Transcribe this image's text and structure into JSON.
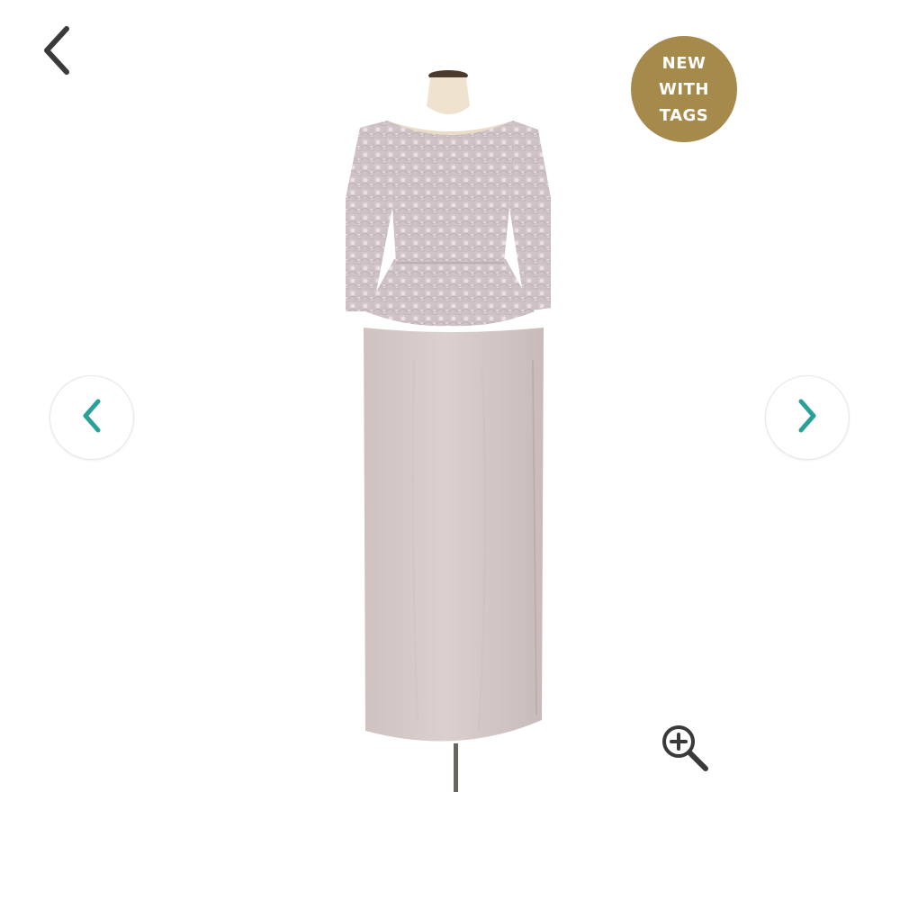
{
  "navigation": {
    "back_icon": "chevron-left-icon",
    "prev_icon": "chevron-left-icon",
    "next_icon": "chevron-right-icon",
    "arrow_color": "#2aa198"
  },
  "badge": {
    "lines": [
      "NEW",
      "WITH",
      "TAGS"
    ],
    "color": "#a68a4c"
  },
  "product_image": {
    "subject": "dress-on-mannequin",
    "colors": {
      "lace": "#d3c6c9",
      "skirt": "#d8cccb",
      "form": "#efe2cf"
    }
  },
  "zoom": {
    "icon": "zoom-in-icon"
  }
}
